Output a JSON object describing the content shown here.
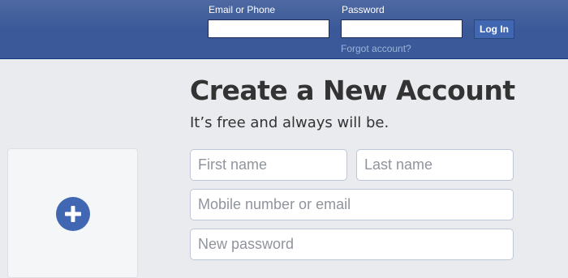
{
  "header": {
    "email_label": "Email or Phone",
    "email_value": "",
    "password_label": "Password",
    "password_value": "",
    "login_button": "Log In",
    "forgot_link": "Forgot account?"
  },
  "signup": {
    "title": "Create a New Account",
    "subtitle": "It’s free and always will be.",
    "first_name_placeholder": "First name",
    "last_name_placeholder": "Last name",
    "contact_placeholder": "Mobile number or email",
    "password_placeholder": "New password"
  },
  "photo_panel": {
    "icon": "plus-circle-icon"
  },
  "colors": {
    "header_bg": "#3b5998",
    "button_bg": "#4267b2",
    "page_bg": "#e9ebee",
    "link": "#9cb4d8",
    "headline": "#333333"
  }
}
